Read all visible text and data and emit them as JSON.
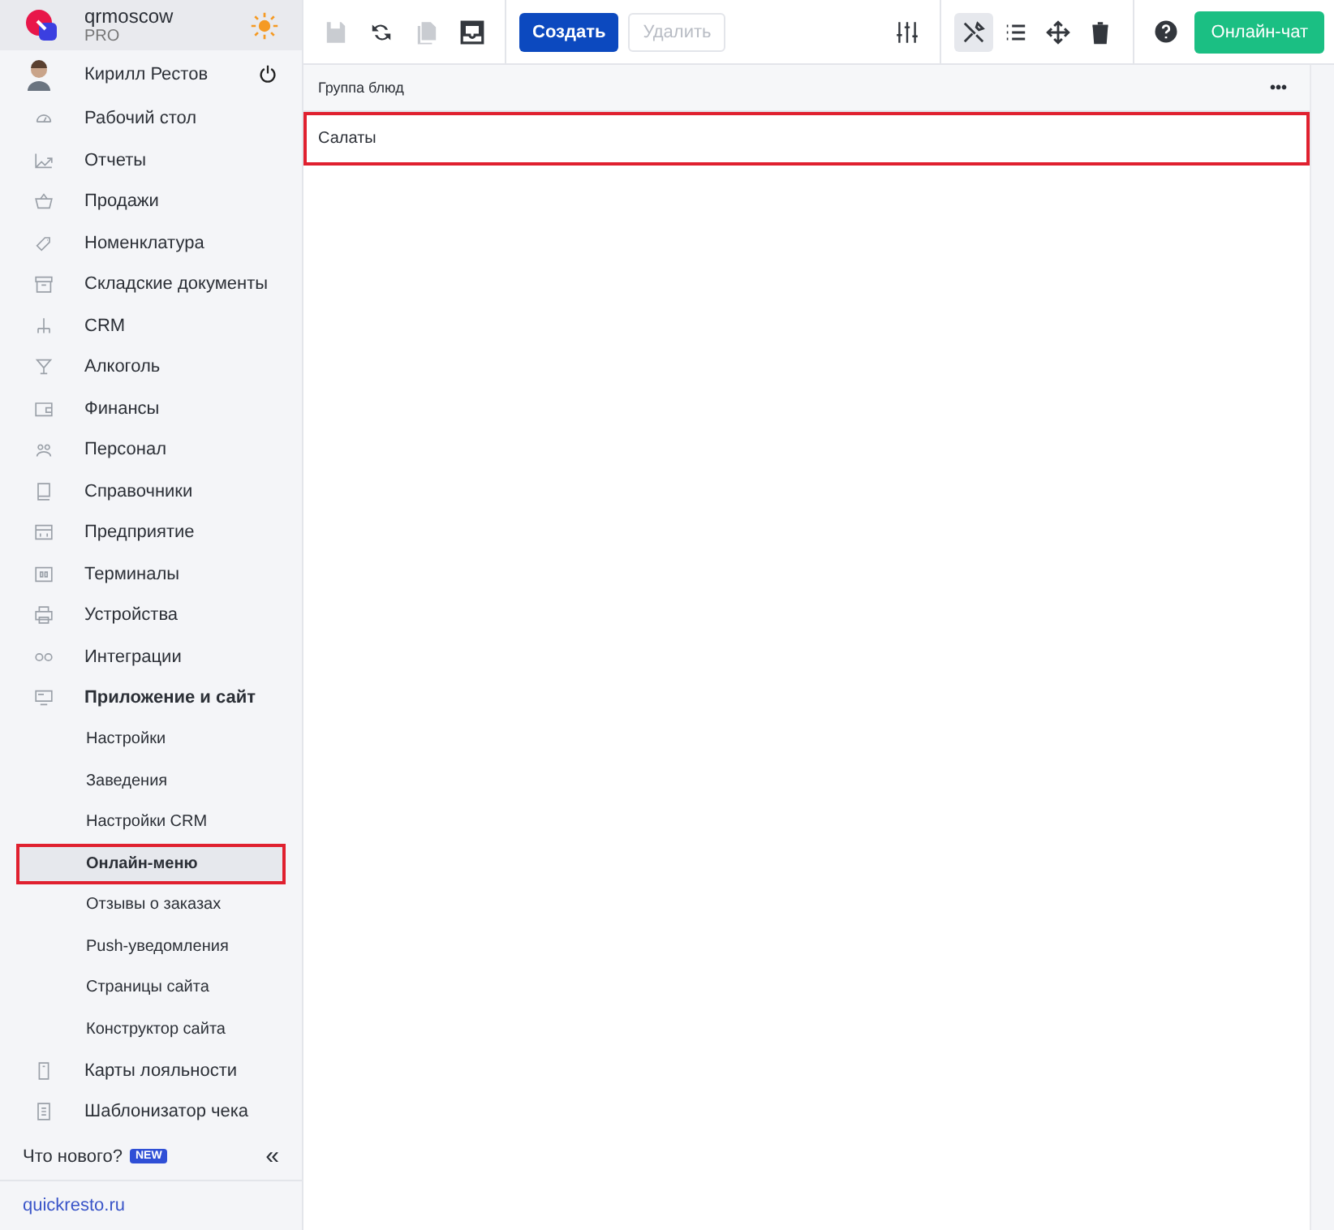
{
  "brand": {
    "name": "qrmoscow",
    "plan": "PRO"
  },
  "user": {
    "name": "Кирилл Рестов"
  },
  "menu": [
    {
      "label": "Рабочий стол",
      "selected": false,
      "highlighted": false,
      "expanded": false
    },
    {
      "label": "Отчеты",
      "selected": false,
      "highlighted": false,
      "expanded": false
    },
    {
      "label": "Продажи",
      "selected": false,
      "highlighted": false,
      "expanded": false
    },
    {
      "label": "Номенклатура",
      "selected": false,
      "highlighted": false,
      "expanded": false
    },
    {
      "label": "Складские документы",
      "selected": false,
      "highlighted": false,
      "expanded": false
    },
    {
      "label": "CRM",
      "selected": false,
      "highlighted": false,
      "expanded": false
    },
    {
      "label": "Алкоголь",
      "selected": false,
      "highlighted": false,
      "expanded": false
    },
    {
      "label": "Финансы",
      "selected": false,
      "highlighted": false,
      "expanded": false
    },
    {
      "label": "Персонал",
      "selected": false,
      "highlighted": false,
      "expanded": false
    },
    {
      "label": "Справочники",
      "selected": false,
      "highlighted": false,
      "expanded": false
    },
    {
      "label": "Предприятие",
      "selected": false,
      "highlighted": false,
      "expanded": false
    },
    {
      "label": "Терминалы",
      "selected": false,
      "highlighted": false,
      "expanded": false
    },
    {
      "label": "Устройства",
      "selected": false,
      "highlighted": false,
      "expanded": false
    },
    {
      "label": "Интеграции",
      "selected": false,
      "highlighted": false,
      "expanded": false
    },
    {
      "label": "Приложение и сайт",
      "selected": false,
      "highlighted": false,
      "expanded": true,
      "children": [
        {
          "label": "Настройки",
          "selected": false,
          "highlighted": false
        },
        {
          "label": "Заведения",
          "selected": false,
          "highlighted": false
        },
        {
          "label": "Настройки CRM",
          "selected": false,
          "highlighted": false
        },
        {
          "label": "Онлайн-меню",
          "selected": true,
          "highlighted": true
        },
        {
          "label": "Отзывы о заказах",
          "selected": false,
          "highlighted": false
        },
        {
          "label": "Push-уведомления",
          "selected": false,
          "highlighted": false
        },
        {
          "label": "Страницы сайта",
          "selected": false,
          "highlighted": false
        },
        {
          "label": "Конструктор сайта",
          "selected": false,
          "highlighted": false
        }
      ]
    },
    {
      "label": "Карты лояльности",
      "selected": false,
      "highlighted": false,
      "expanded": false
    },
    {
      "label": "Шаблонизатор чека",
      "selected": false,
      "highlighted": false,
      "expanded": false
    }
  ],
  "whats_new": {
    "label": "Что нового?",
    "badge": "NEW"
  },
  "collapse": "«",
  "site_link": "quickresto.ru",
  "toolbar": {
    "file_tools": [
      {
        "kind": "save",
        "disabled": true
      },
      {
        "kind": "refresh",
        "disabled": false
      },
      {
        "kind": "copy",
        "disabled": true
      },
      {
        "kind": "inbox",
        "disabled": false
      }
    ],
    "create": {
      "label": "Создать",
      "disabled": false
    },
    "delete": {
      "label": "Удалить",
      "disabled": true
    },
    "view_tools": [
      {
        "kind": "tools",
        "selected": true
      },
      {
        "kind": "list",
        "selected": false
      },
      {
        "kind": "move",
        "selected": false
      },
      {
        "kind": "trash",
        "selected": false
      }
    ],
    "chat": "Онлайн-чат"
  },
  "table": {
    "columns": [
      "Группа блюд"
    ],
    "more": "•••",
    "rows": [
      {
        "cells": [
          "Салаты"
        ],
        "highlighted": true
      }
    ]
  }
}
